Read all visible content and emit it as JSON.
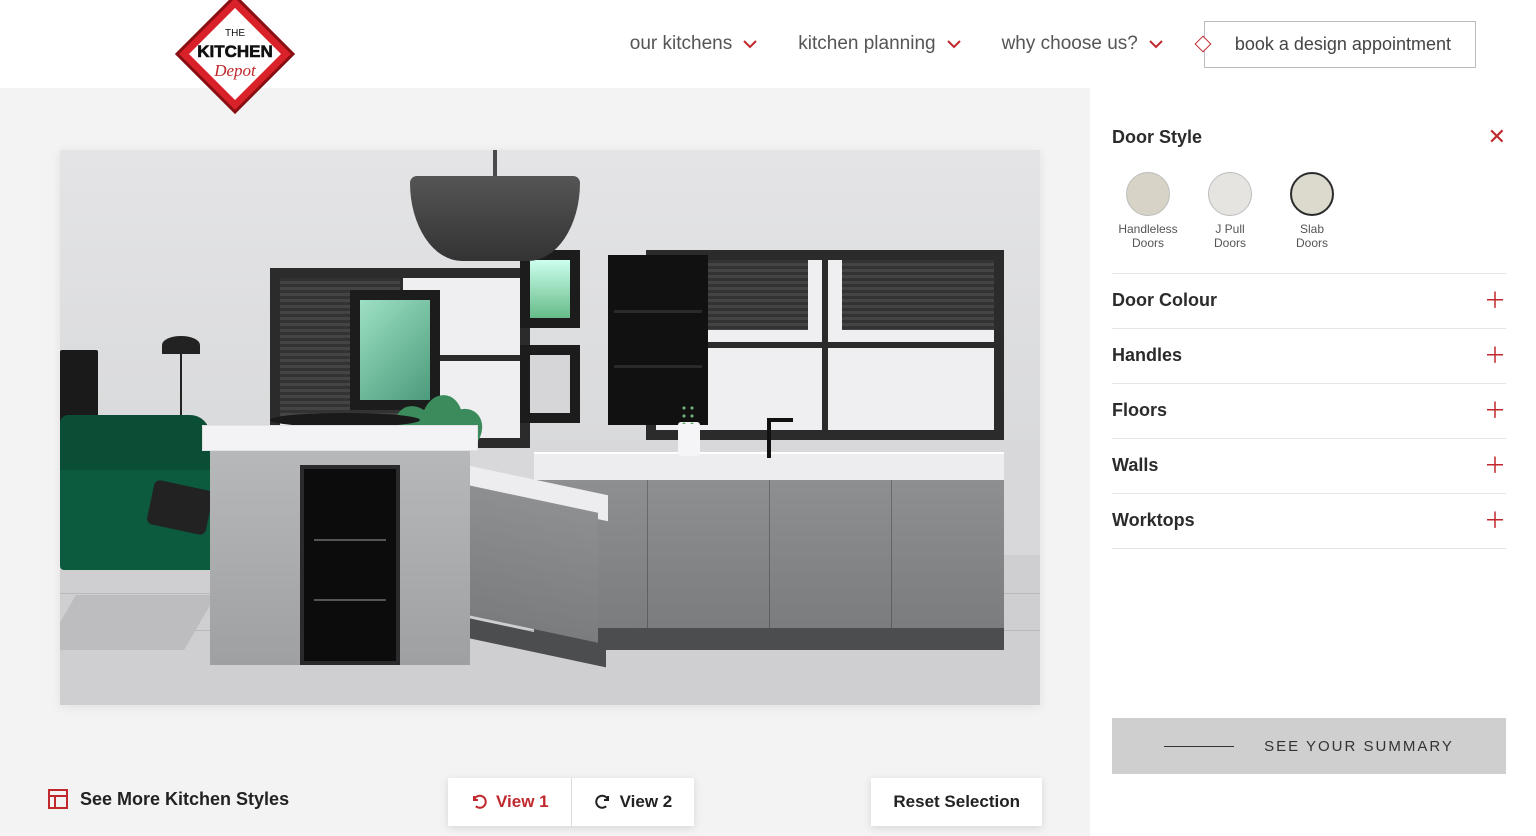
{
  "brand": {
    "line1": "THE",
    "line2": "KITCHEN",
    "line3": "Depot"
  },
  "nav": {
    "items": [
      {
        "label": "our kitchens"
      },
      {
        "label": "kitchen planning"
      },
      {
        "label": "why choose us?"
      }
    ],
    "cta": "book a design appointment"
  },
  "toolbar": {
    "more_styles": "See More Kitchen Styles",
    "view1": "View 1",
    "view2": "View 2",
    "reset": "Reset Selection"
  },
  "panel": {
    "sections": [
      {
        "title": "Door Style",
        "expanded": true
      },
      {
        "title": "Door Colour",
        "expanded": false
      },
      {
        "title": "Handles",
        "expanded": false
      },
      {
        "title": "Floors",
        "expanded": false
      },
      {
        "title": "Walls",
        "expanded": false
      },
      {
        "title": "Worktops",
        "expanded": false
      }
    ],
    "door_styles": [
      {
        "label_l1": "Handleless",
        "label_l2": "Doors",
        "selected": false
      },
      {
        "label_l1": "J Pull",
        "label_l2": "Doors",
        "selected": false
      },
      {
        "label_l1": "Slab",
        "label_l2": "Doors",
        "selected": true
      }
    ],
    "summary_cta": "SEE YOUR SUMMARY"
  }
}
